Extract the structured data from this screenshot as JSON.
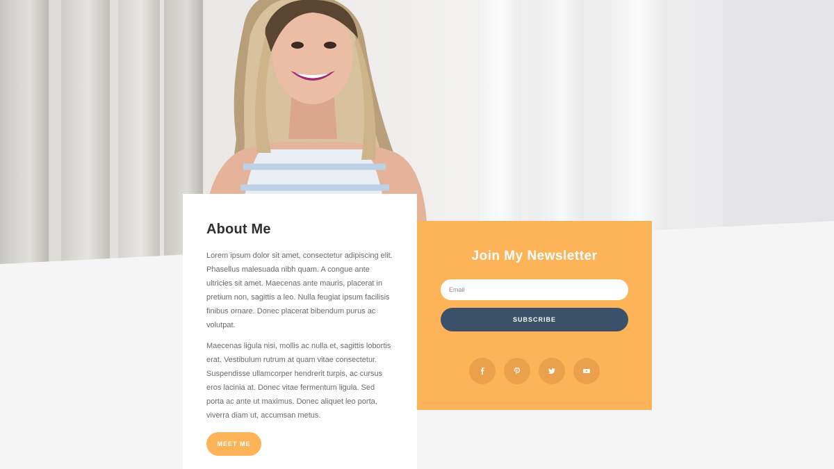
{
  "hero": {
    "image_alt": "Smiling woman with long blonde hair leaning against white columns"
  },
  "about": {
    "title": "About Me",
    "paragraph_1": "Lorem ipsum dolor sit amet, consectetur adipiscing elit. Phasellus malesuada nibh quam. A congue ante ultricies sit amet. Maecenas ante mauris, placerat in pretium non, sagittis a leo. Nulla feugiat ipsum facilisis finibus ornare. Donec placerat bibendum purus ac volutpat.",
    "paragraph_2": "Maecenas ligula nisi, mollis ac nulla et, sagittis lobortis erat. Vestibulum rutrum at quam vitae consectetur. Suspendisse ullamcorper hendrerit turpis, ac cursus eros lacinia at. Donec vitae fermentum ligula. Sed porta ac ante ut maximus. Donec aliquet leo porta, viverra diam ut, accumsan metus.",
    "button_label": "MEET ME"
  },
  "newsletter": {
    "title": "Join My Newsletter",
    "email_placeholder": "Email",
    "email_value": "",
    "subscribe_label": "SUBSCRIBE",
    "socials": [
      {
        "icon": "facebook-icon"
      },
      {
        "icon": "pinterest-icon"
      },
      {
        "icon": "twitter-icon"
      },
      {
        "icon": "youtube-icon"
      }
    ]
  },
  "colors": {
    "accent": "#fdb458",
    "accent_dark": "#eba14b",
    "navy": "#3b5069",
    "background": "#f5f5f5"
  }
}
